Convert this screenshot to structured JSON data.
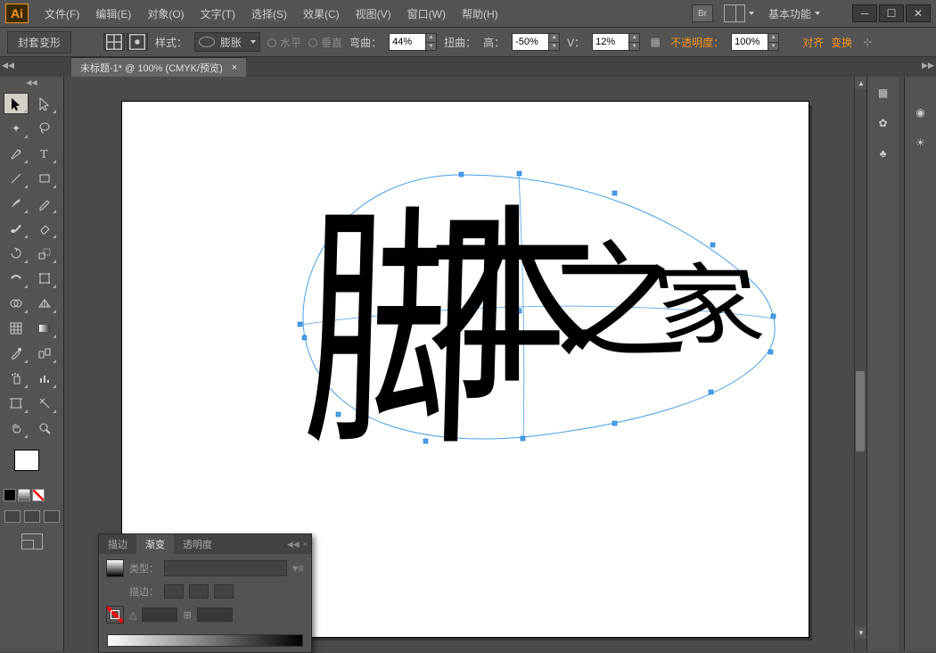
{
  "app": {
    "logo": "Ai"
  },
  "menus": {
    "file": "文件(F)",
    "edit": "编辑(E)",
    "object": "对象(O)",
    "type": "文字(T)",
    "select": "选择(S)",
    "effect": "效果(C)",
    "view": "视图(V)",
    "window": "窗口(W)",
    "help": "帮助(H)"
  },
  "workspace": "基本功能",
  "envelope_mode": "封套变形",
  "style": {
    "label": "样式：",
    "value": "膨胀"
  },
  "orient": {
    "h": "水平",
    "v": "垂直"
  },
  "bend": {
    "label": "弯曲：",
    "value": "44%"
  },
  "distort": {
    "label": "扭曲：",
    "hlabel": "高：",
    "hval": "-50%",
    "vlabel": "V：",
    "vval": "12%"
  },
  "opacity": {
    "label": "不透明度：",
    "value": "100%"
  },
  "align": "对齐",
  "transform": "变换",
  "doc_tab": "未标题-1* @ 100% (CMYK/预览)",
  "canvas_text": "脚本之家",
  "panel": {
    "tabs": {
      "stroke": "描边",
      "gradient": "渐变",
      "transparency": "透明度"
    },
    "type_label": "类型：",
    "stroke_label": "描边：",
    "angle_icon": "△",
    "ratio_icon": "⊞"
  }
}
